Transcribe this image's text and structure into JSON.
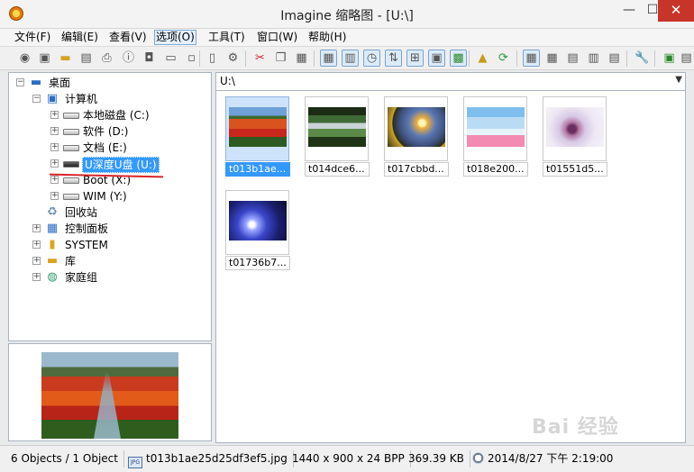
{
  "window": {
    "title": "Imagine 缩略图 - [U:\\]",
    "minimize": "—",
    "maximize": "☐",
    "close": "✕"
  },
  "menu": [
    "文件(F)",
    "编辑(E)",
    "查看(V)",
    "选项(O)",
    "工具(T)",
    "窗口(W)",
    "帮助(H)"
  ],
  "menu_active_index": 3,
  "toolbar": {
    "icons": [
      "view-icon",
      "browse-icon",
      "open-folder-icon",
      "save-icon",
      "print-icon",
      "info-icon",
      "camera-icon",
      "scan-icon",
      "slideshow-icon",
      "delete-icon",
      "properties-icon",
      "cut-icon",
      "copy-icon",
      "paste-icon",
      "thumbnail-mode-icon",
      "film-icon",
      "clock-icon",
      "sort-icon",
      "grid-icon",
      "frame-icon",
      "fullscreen-icon",
      "folder-up-icon",
      "refresh-icon",
      "large-icons-icon",
      "small-icons-icon",
      "list-icon",
      "details-icon",
      "table-icon",
      "settings-icon",
      "plugin-icon",
      "export-icon"
    ]
  },
  "tree": {
    "items": [
      {
        "label": "桌面",
        "icon": "desktop-icon",
        "expander": "−"
      },
      {
        "label": "计算机",
        "icon": "computer-icon",
        "expander": "−"
      },
      {
        "label": "本地磁盘 (C:)",
        "icon": "drive-icon",
        "expander": "+"
      },
      {
        "label": "软件 (D:)",
        "icon": "drive-icon",
        "expander": "+"
      },
      {
        "label": "文档 (E:)",
        "icon": "drive-icon",
        "expander": "+"
      },
      {
        "label": "U深度U盘 (U:)",
        "icon": "usb-drive-icon",
        "expander": "+",
        "selected": true
      },
      {
        "label": "Boot (X:)",
        "icon": "drive-icon",
        "expander": "+"
      },
      {
        "label": "WIM (Y:)",
        "icon": "drive-icon",
        "expander": "+"
      },
      {
        "label": "回收站",
        "icon": "recycle-bin-icon",
        "expander": ""
      },
      {
        "label": "控制面板",
        "icon": "control-panel-icon",
        "expander": "+"
      },
      {
        "label": "SYSTEM",
        "icon": "user-folder-icon",
        "expander": "+"
      },
      {
        "label": "库",
        "icon": "library-icon",
        "expander": "+"
      },
      {
        "label": "家庭组",
        "icon": "homegroup-icon",
        "expander": "+"
      }
    ]
  },
  "address": {
    "path": "U:\\"
  },
  "thumbnails": [
    {
      "name": "t013b1ae...",
      "selected": true
    },
    {
      "name": "t014dce6..."
    },
    {
      "name": "t017cbbd..."
    },
    {
      "name": "t018e200..."
    },
    {
      "name": "t01551d5..."
    },
    {
      "name": "t01736b7..."
    }
  ],
  "status": {
    "objects": "6 Objects / 1 Object",
    "filename": "t013b1ae25d25df3ef5.jpg",
    "dimensions": "1440 x 900 x 24 BPP",
    "size": "369.39 KB",
    "datetime": "2014/8/27 下午 2:19:00"
  },
  "watermark": "Bai 经验"
}
